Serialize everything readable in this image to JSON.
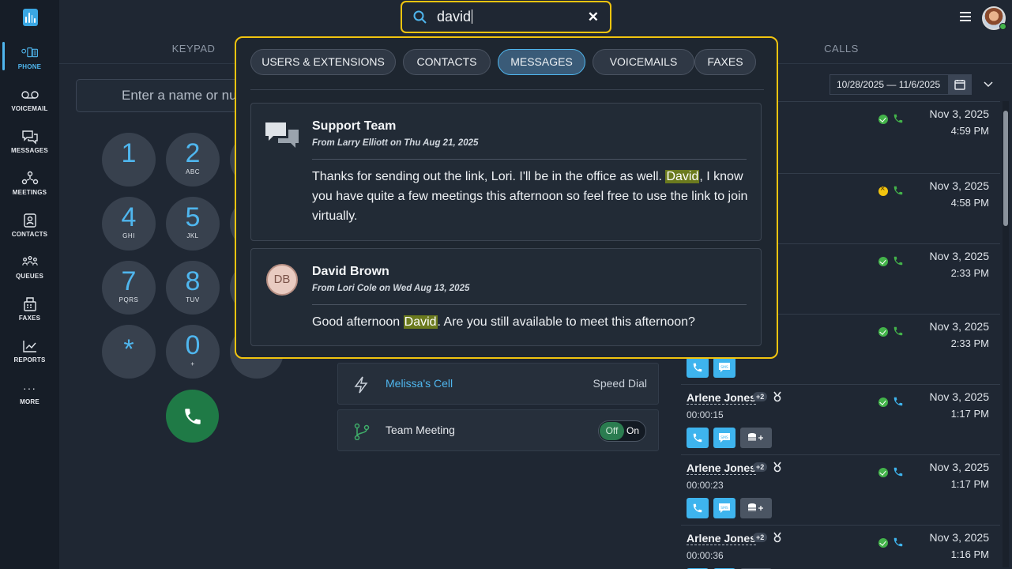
{
  "nav": {
    "items": [
      {
        "label": "PHONE",
        "icon": "phone-icon"
      },
      {
        "label": "VOICEMAIL",
        "icon": "voicemail-icon"
      },
      {
        "label": "MESSAGES",
        "icon": "messages-icon"
      },
      {
        "label": "MEETINGS",
        "icon": "meetings-icon"
      },
      {
        "label": "CONTACTS",
        "icon": "contacts-icon"
      },
      {
        "label": "QUEUES",
        "icon": "queues-icon"
      },
      {
        "label": "FAXES",
        "icon": "fax-icon"
      },
      {
        "label": "REPORTS",
        "icon": "reports-icon"
      },
      {
        "label": "MORE",
        "icon": "more-icon"
      }
    ]
  },
  "tabs": {
    "keypad": "KEYPAD",
    "calls": "CALLS"
  },
  "search": {
    "value": "david"
  },
  "keypad": {
    "input_placeholder": "Enter a name or number",
    "keys": [
      {
        "num": "1",
        "sub": ""
      },
      {
        "num": "2",
        "sub": "ABC"
      },
      {
        "num": "4",
        "sub": "GHI"
      },
      {
        "num": "5",
        "sub": "JKL"
      },
      {
        "num": "7",
        "sub": "PQRS"
      },
      {
        "num": "8",
        "sub": "TUV"
      },
      {
        "num": "*",
        "sub": ""
      },
      {
        "num": "0",
        "sub": "+"
      }
    ]
  },
  "speed_dials": [
    {
      "name": "Melissa's Cell",
      "type": "Speed Dial"
    },
    {
      "name": "Team Meeting",
      "toggle_off": "Off",
      "toggle_on": "On"
    }
  ],
  "calls": {
    "date_range": "10/28/2025 — 11/6/2025",
    "rows": [
      {
        "name": "",
        "duration": "",
        "date": "Nov 3, 2025",
        "time": "4:59 PM",
        "status": "answered"
      },
      {
        "name": "",
        "duration": "",
        "date": "Nov 3, 2025",
        "time": "4:58 PM",
        "status": "missed"
      },
      {
        "name": "",
        "duration": "",
        "date": "Nov 3, 2025",
        "time": "2:33 PM",
        "status": "answered"
      },
      {
        "name": "",
        "duration": "",
        "date": "Nov 3, 2025",
        "time": "2:33 PM",
        "status": "answered"
      },
      {
        "name": "Arlene Jones",
        "badge": "+2",
        "duration": "00:00:15",
        "date": "Nov 3, 2025",
        "time": "1:17 PM",
        "status": "answered"
      },
      {
        "name": "Arlene Jones",
        "badge": "+2",
        "duration": "00:00:23",
        "date": "Nov 3, 2025",
        "time": "1:17 PM",
        "status": "answered"
      },
      {
        "name": "Arlene Jones",
        "badge": "+2",
        "duration": "00:00:36",
        "date": "Nov 3, 2025",
        "time": "1:16 PM",
        "status": "answered"
      }
    ]
  },
  "search_results": {
    "filters": [
      "USERS & EXTENSIONS",
      "CONTACTS",
      "MESSAGES",
      "VOICEMAILS",
      "FAXES"
    ],
    "active_filter": "MESSAGES",
    "results": [
      {
        "title": "Support Team",
        "from": "From Larry Elliott on Thu Aug 21, 2025",
        "body_before": "Thanks for sending out the link, Lori. I'll be in the office as well. ",
        "body_match": "David",
        "body_after": ", I know you have quite a few meetings this afternoon so feel free to use the link to join virtually."
      },
      {
        "title": "David Brown",
        "initials": "DB",
        "from": "From Lori Cole on Wed Aug 13, 2025",
        "body_before": "Good afternoon ",
        "body_match": "David",
        "body_after": ". Are you still available to meet this afternoon?"
      }
    ]
  },
  "colors": {
    "accent": "#4fb6ee",
    "highlight_border": "#f1c40f",
    "answered": "#43b34a",
    "missed": "#f1c40f",
    "match_highlight": "#6b7a1e"
  }
}
